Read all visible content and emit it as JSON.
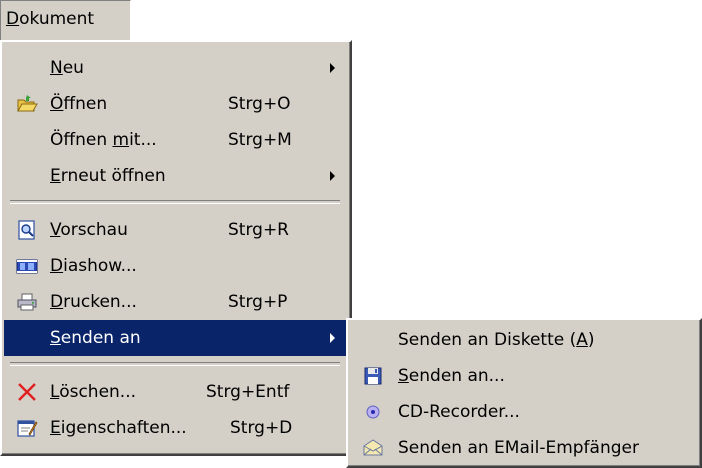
{
  "menubar": {
    "dokument": {
      "pre": "",
      "mn": "D",
      "post": "okument"
    }
  },
  "main_menu": {
    "neu": {
      "pre": "",
      "mn": "N",
      "post": "eu",
      "shortcut": ""
    },
    "oeffnen": {
      "pre": "",
      "mn": "Ö",
      "post": "ffnen",
      "shortcut": "Strg+O"
    },
    "oeffnen_mit": {
      "pre": "Öffnen ",
      "mn": "m",
      "post": "it...",
      "shortcut": "Strg+M"
    },
    "erneut": {
      "pre": "",
      "mn": "E",
      "post": "rneut öffnen",
      "shortcut": ""
    },
    "vorschau": {
      "pre": "",
      "mn": "V",
      "post": "orschau",
      "shortcut": "Strg+R"
    },
    "diashow": {
      "pre": "",
      "mn": "D",
      "post": "iashow...",
      "shortcut": ""
    },
    "drucken": {
      "pre": "",
      "mn": "D",
      "post": "rucken...",
      "shortcut": "Strg+P"
    },
    "senden": {
      "pre": "",
      "mn": "S",
      "post": "enden an",
      "shortcut": ""
    },
    "loeschen": {
      "pre": "",
      "mn": "L",
      "post": "öschen...",
      "shortcut": "Strg+Entf"
    },
    "eigenschaften": {
      "pre": "",
      "mn": "E",
      "post": "igenschaften...",
      "shortcut": "Strg+D"
    }
  },
  "sub_menu": {
    "diskette": {
      "pre": "Senden an Diskette (",
      "mn": "A",
      "post": ")"
    },
    "senden_an": {
      "pre": "",
      "mn": "S",
      "post": "enden an..."
    },
    "cd_recorder": {
      "pre": "CD-Recorder...",
      "mn": "",
      "post": ""
    },
    "email": {
      "pre": "Senden an EMail-Empfänger",
      "mn": "",
      "post": ""
    }
  },
  "icons": {
    "oeffnen": "open-folder-icon",
    "vorschau": "preview-icon",
    "diashow": "slideshow-icon",
    "drucken": "printer-icon",
    "loeschen": "delete-x-icon",
    "eigenschaften": "properties-icon",
    "senden_an": "floppy-disk-icon",
    "cd_recorder": "cd-icon",
    "email": "email-envelope-icon"
  },
  "colors": {
    "menu_bg": "#d4d0c8",
    "selection_bg": "#0a246a",
    "selection_text": "#ffffff"
  }
}
